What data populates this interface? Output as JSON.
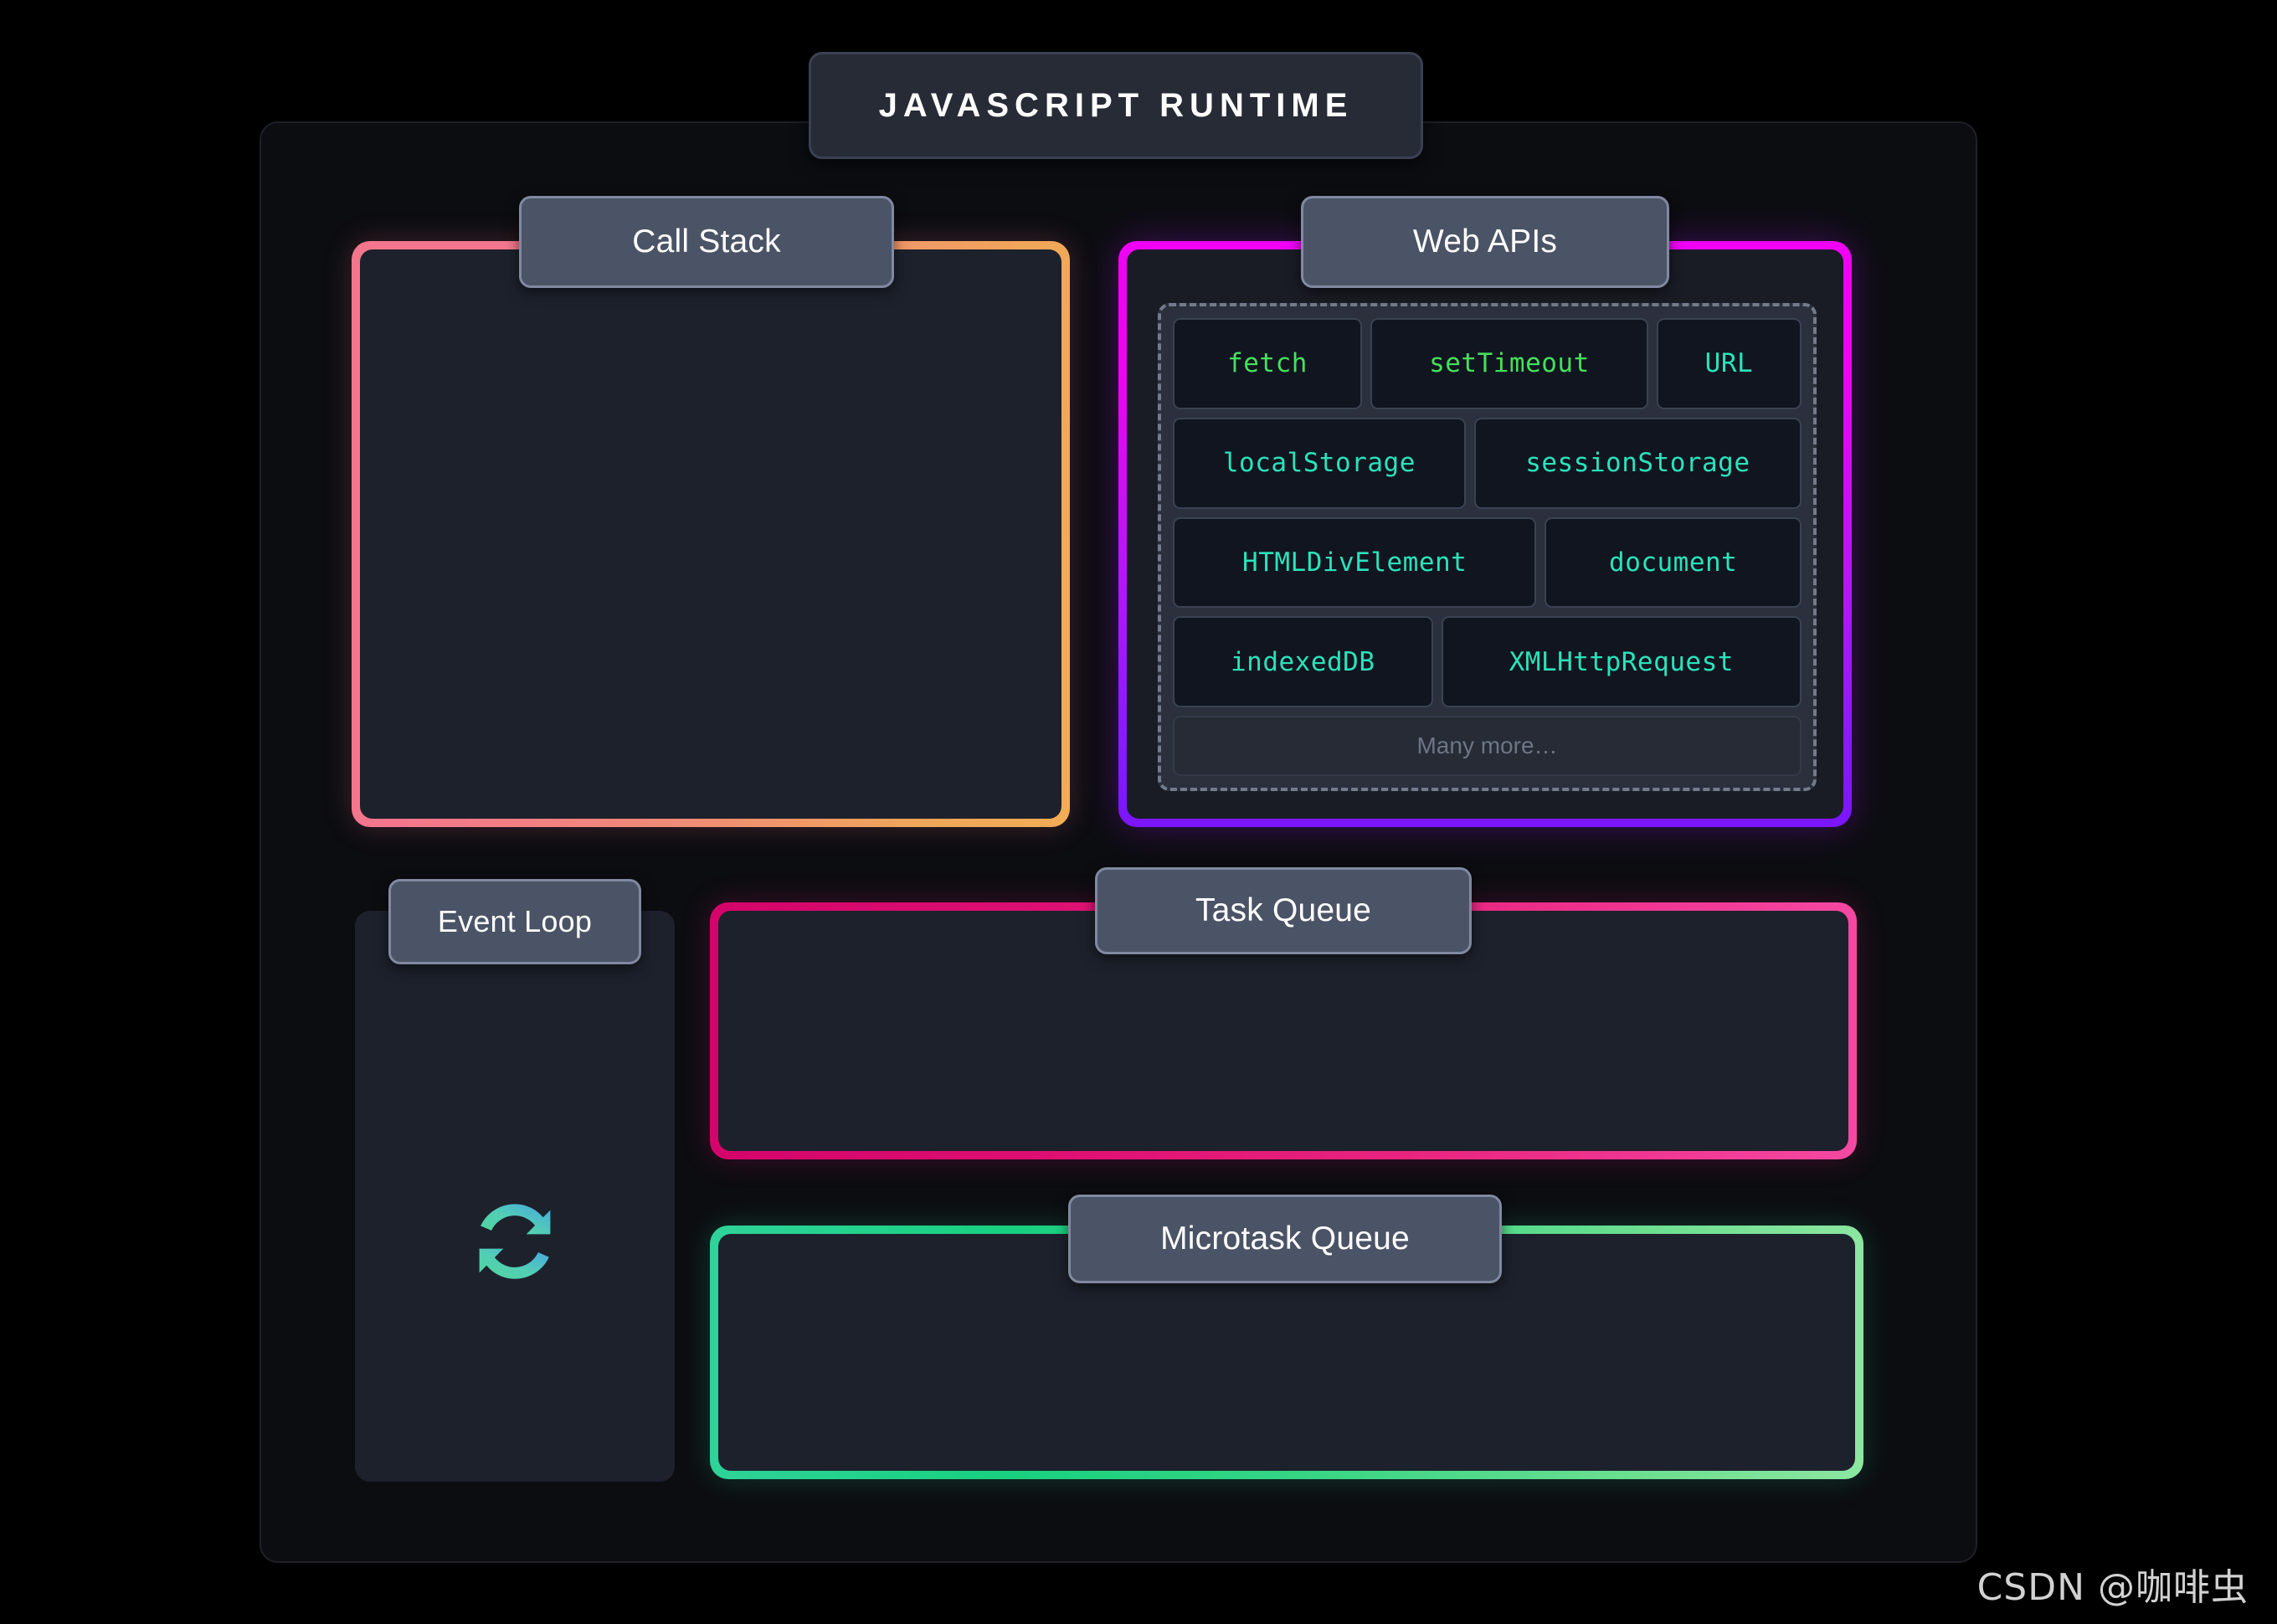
{
  "page": {
    "background_color": "#000000",
    "watermark": "CSDN @咖啡虫"
  },
  "runtime": {
    "title": "JAVASCRIPT RUNTIME",
    "container_color": "#0c0d11"
  },
  "call_stack": {
    "label": "Call Stack",
    "border_gradient_from": "#f4768d",
    "border_gradient_to": "#f2ad55",
    "body_color": "#1d212c",
    "items": []
  },
  "web_apis": {
    "label": "Web APIs",
    "border_gradient_from": "#f000f5",
    "border_gradient_to": "#7a16ff",
    "more_label": "Many more…",
    "rows": [
      [
        {
          "name": "fetch",
          "color": "green"
        },
        {
          "name": "setTimeout",
          "color": "green"
        },
        {
          "name": "URL",
          "color": "teal"
        }
      ],
      [
        {
          "name": "localStorage",
          "color": "teal"
        },
        {
          "name": "sessionStorage",
          "color": "teal"
        }
      ],
      [
        {
          "name": "HTMLDivElement",
          "color": "teal"
        },
        {
          "name": "document",
          "color": "teal"
        }
      ],
      [
        {
          "name": "indexedDB",
          "color": "teal"
        },
        {
          "name": "XMLHttpRequest",
          "color": "teal"
        }
      ]
    ],
    "green_color": "#45e05c",
    "teal_color": "#2ae3bb"
  },
  "event_loop": {
    "label": "Event Loop",
    "icon": "circular-arrows-refresh-icon",
    "icon_gradient_from": "#4fd69c",
    "icon_gradient_to": "#4aa8e0",
    "body_color": "#1d212c"
  },
  "task_queue": {
    "label": "Task Queue",
    "border_gradient_from": "#d4046a",
    "border_gradient_to": "#f549a2",
    "body_color": "#1d212c",
    "items": []
  },
  "microtask_queue": {
    "label": "Microtask Queue",
    "border_gradient_from": "#2fd39a",
    "border_gradient_to": "#8ce6a1",
    "body_color": "#1d212c",
    "items": []
  },
  "label_pill": {
    "background": "#4b5366",
    "border": "#8089a0"
  }
}
